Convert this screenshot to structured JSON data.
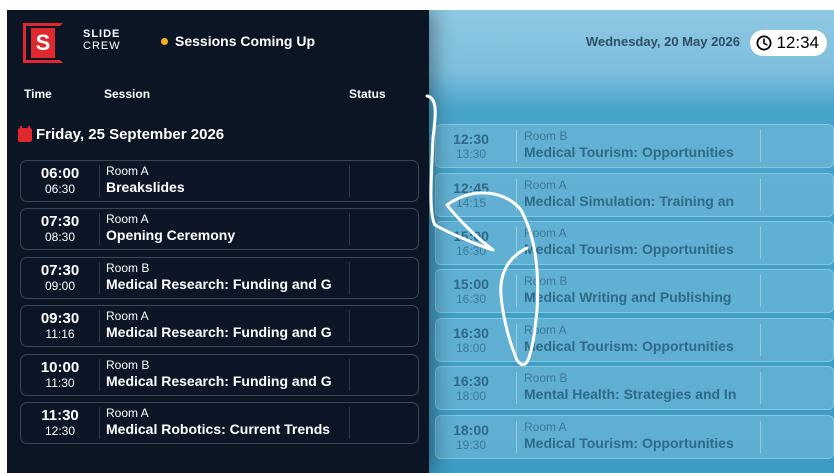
{
  "header": {
    "logo_letter": "S",
    "brand_line1": "SLIDE",
    "brand_line2": "CREW",
    "sessions_label": "Sessions Coming Up",
    "date": "Wednesday, 20 May 2026",
    "time": "12:34"
  },
  "columns": {
    "time": "Time",
    "session": "Session",
    "status": "Status"
  },
  "day": {
    "label": "Friday, 25 September 2026"
  },
  "left_sessions": [
    {
      "start": "06:00",
      "end": "06:30",
      "room": "Room A",
      "title": "Breakslides"
    },
    {
      "start": "07:30",
      "end": "08:30",
      "room": "Room A",
      "title": "Opening Ceremony"
    },
    {
      "start": "07:30",
      "end": "09:00",
      "room": "Room B",
      "title": "Medical Research: Funding and G"
    },
    {
      "start": "09:30",
      "end": "11:16",
      "room": "Room A",
      "title": "Medical Research: Funding and G"
    },
    {
      "start": "10:00",
      "end": "11:30",
      "room": "Room B",
      "title": "Medical Research: Funding and G"
    },
    {
      "start": "11:30",
      "end": "12:30",
      "room": "Room A",
      "title": "Medical Robotics: Current Trends"
    }
  ],
  "right_sessions": [
    {
      "start": "12:30",
      "end": "13:30",
      "room": "Room B",
      "title": "Medical Tourism: Opportunities"
    },
    {
      "start": "12:45",
      "end": "14:15",
      "room": "Room A",
      "title": "Medical Simulation: Training an"
    },
    {
      "start": "15:00",
      "end": "16:30",
      "room": "Room A",
      "title": "Medical Tourism: Opportunities"
    },
    {
      "start": "15:00",
      "end": "16:30",
      "room": "Room B",
      "title": "Medical Writing and Publishing"
    },
    {
      "start": "16:30",
      "end": "18:00",
      "room": "Room A",
      "title": "Medical Tourism: Opportunities"
    },
    {
      "start": "16:30",
      "end": "18:00",
      "room": "Room B",
      "title": "Mental Health: Strategies and In"
    },
    {
      "start": "18:00",
      "end": "19:30",
      "room": "Room A",
      "title": "Medical Tourism: Opportunities"
    }
  ],
  "icons": {
    "clock": "clock-icon",
    "calendar": "calendar-icon",
    "status_dot": "status-dot"
  },
  "colors": {
    "brand_red": "#e0292f",
    "panel_bg": "#0c1524",
    "accent_dot": "#f6b21b",
    "right_bg": "#48a3c9"
  }
}
